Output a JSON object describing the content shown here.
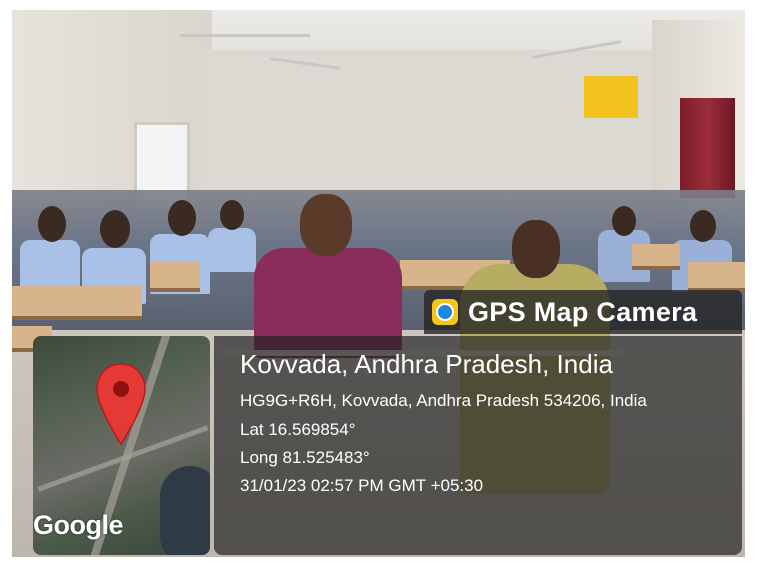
{
  "overlay": {
    "app_name": "GPS Map Camera",
    "app_icon": "gps-map-camera-logo",
    "map_provider": "Google",
    "location_title": "Kovvada, Andhra Pradesh, India",
    "address": "HG9G+R6H, Kovvada, Andhra Pradesh 534206, India",
    "latitude": "Lat 16.569854°",
    "longitude": "Long 81.525483°",
    "timestamp": "31/01/23 02:57 PM GMT +05:30"
  },
  "colors": {
    "overlay_bg": "#232323",
    "text": "#ffffff",
    "pin": "#e53935",
    "app_icon_yellow": "#f5c518",
    "app_icon_blue": "#1e88e5"
  }
}
